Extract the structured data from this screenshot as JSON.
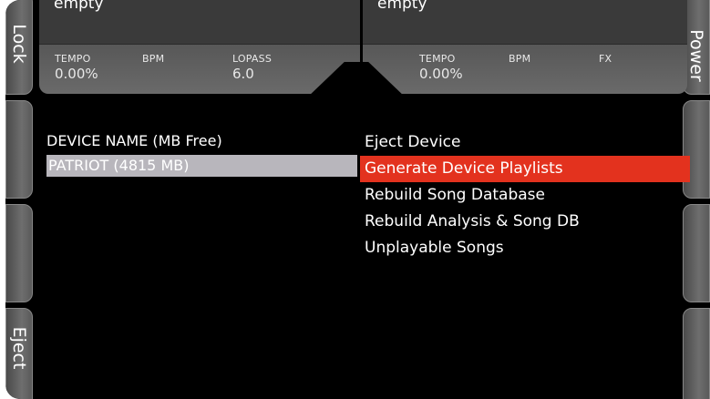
{
  "side_keys": {
    "left": [
      "Lock",
      "",
      "",
      "Eject"
    ],
    "right": [
      "Power",
      "",
      "",
      ""
    ]
  },
  "decks": [
    {
      "track": "empty",
      "meters": [
        {
          "label": "TEMPO",
          "value": "0.00%"
        },
        {
          "label": "BPM",
          "value": ""
        },
        {
          "label": "LOPASS",
          "value": "6.0"
        }
      ]
    },
    {
      "track": "empty",
      "meters": [
        {
          "label": "TEMPO",
          "value": "0.00%"
        },
        {
          "label": "BPM",
          "value": ""
        },
        {
          "label": "FX",
          "value": ""
        }
      ]
    }
  ],
  "device_list": {
    "header": "DEVICE NAME (MB Free)",
    "items": [
      "PATRIOT (4815 MB)"
    ]
  },
  "menu": {
    "items": [
      "Eject Device",
      "Generate Device Playlists",
      "Rebuild Song Database",
      "Rebuild Analysis & Song DB",
      "Unplayable Songs"
    ],
    "selected_index": 1
  },
  "colors": {
    "highlight": "#e3321e",
    "device_selected": "#b8b6bc"
  }
}
